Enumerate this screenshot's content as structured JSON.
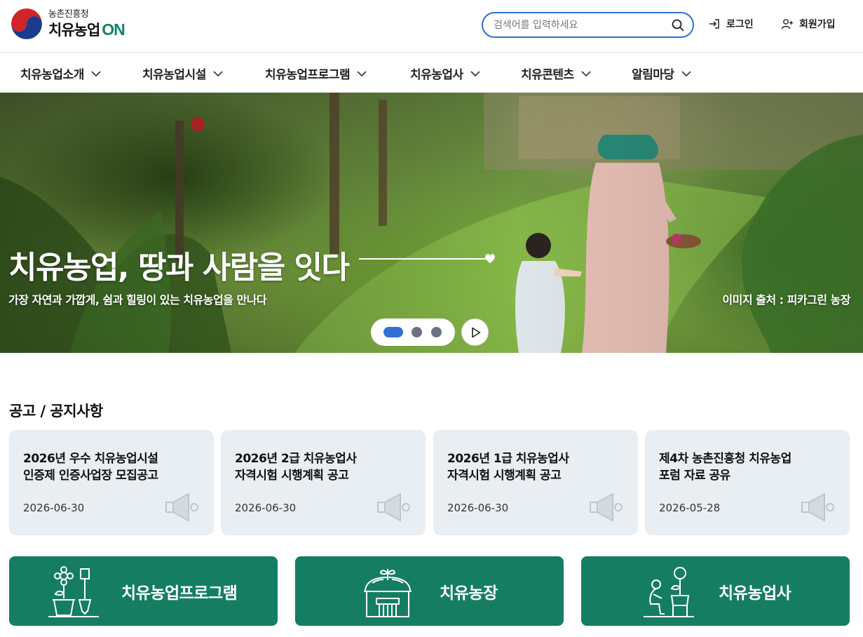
{
  "header": {
    "logo_sub": "농촌진흥청",
    "logo_main": "치유농업",
    "logo_on": "ON",
    "search_placeholder": "검색어를 입력하세요",
    "login": "로그인",
    "signup": "회원가입"
  },
  "nav": {
    "items": [
      "치유농업소개",
      "치유농업시설",
      "치유농업프로그램",
      "치유농업사",
      "치유콘텐츠",
      "알림마당"
    ]
  },
  "hero": {
    "title": "치유농업, 땅과 사람을 잇다",
    "subtitle": "가장 자연과 가깝게, 쉼과 힐링이 있는 치유농업을 만나다",
    "credit": "이미지 출처 : 피카그린 농장",
    "slide_count": 3,
    "active_slide": 1
  },
  "notices": {
    "title": "공고 / 공지사항",
    "items": [
      {
        "title_line1": "2026년 우수 치유농업시설",
        "title_line2": "인증제 인증사업장 모집공고",
        "date": "2026-06-30"
      },
      {
        "title_line1": "2026년 2급 치유농업사",
        "title_line2": "자격시험 시행계획 공고",
        "date": "2026-06-30"
      },
      {
        "title_line1": "2026년 1급 치유농업사",
        "title_line2": "자격시험 시행계획 공고",
        "date": "2026-06-30"
      },
      {
        "title_line1": "제4차 농촌진흥청 치유농업",
        "title_line2": "포럼 자료 공유",
        "date": "2026-05-28"
      }
    ]
  },
  "quick_links": [
    {
      "label": "치유농업프로그램",
      "icon": "flower-shovel-icon"
    },
    {
      "label": "치유농장",
      "icon": "greenhouse-icon"
    },
    {
      "label": "치유농업사",
      "icon": "gardener-icon"
    }
  ],
  "colors": {
    "brand_green": "#157e62",
    "accent_blue": "#2f6fd6",
    "card_bg": "#e8eef2"
  }
}
